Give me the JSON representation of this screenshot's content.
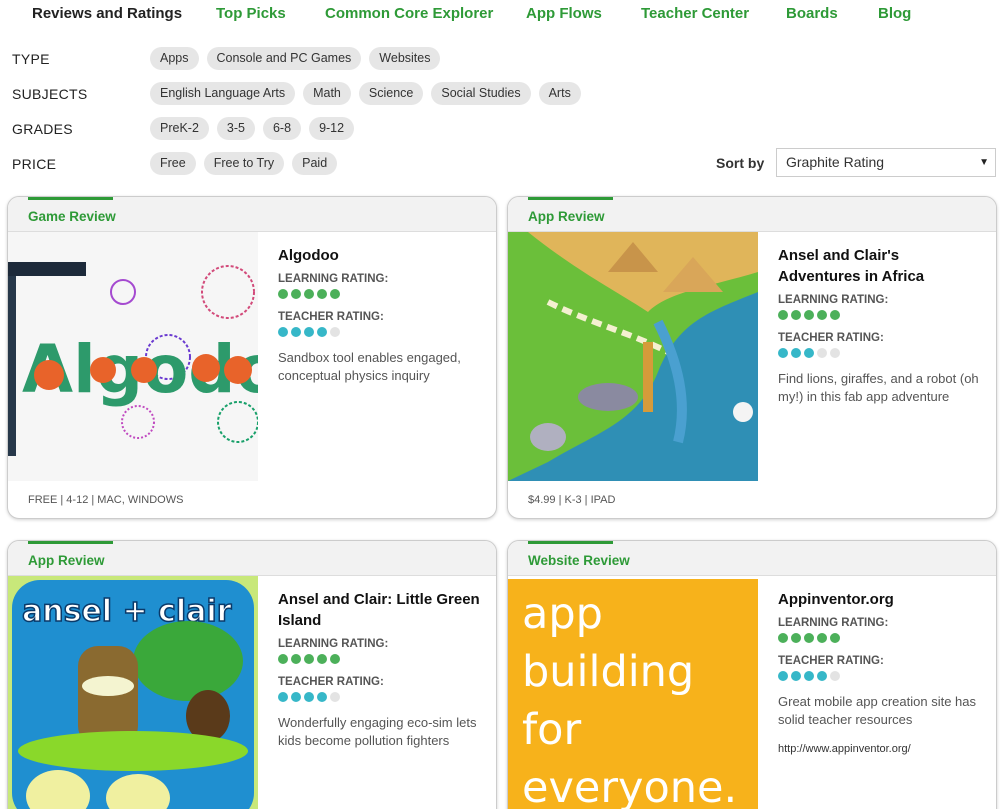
{
  "nav": {
    "items": [
      "Reviews and Ratings",
      "Top Picks",
      "Common Core Explorer",
      "App Flows",
      "Teacher Center",
      "Boards",
      "Blog"
    ]
  },
  "filters": {
    "type": {
      "label": "TYPE",
      "options": [
        "Apps",
        "Console and PC Games",
        "Websites"
      ]
    },
    "subjects": {
      "label": "SUBJECTS",
      "options": [
        "English Language Arts",
        "Math",
        "Science",
        "Social Studies",
        "Arts"
      ]
    },
    "grades": {
      "label": "GRADES",
      "options": [
        "PreK-2",
        "3-5",
        "6-8",
        "9-12"
      ]
    },
    "price": {
      "label": "PRICE",
      "options": [
        "Free",
        "Free to Try",
        "Paid"
      ]
    }
  },
  "sort": {
    "label": "Sort by",
    "value": "Graphite Rating"
  },
  "ratings_labels": {
    "learning": "LEARNING RATING:",
    "teacher": "TEACHER RATING:"
  },
  "cards": [
    {
      "type": "Game Review",
      "title": "Algodoo",
      "learning": 5,
      "teacher": 4,
      "description": "Sandbox tool enables engaged, conceptual physics inquiry",
      "footer": "FREE | 4-12 | MAC, WINDOWS",
      "thumb_text": "Algodoo"
    },
    {
      "type": "App Review",
      "title": "Ansel and Clair's Adventures in Africa",
      "learning": 5,
      "teacher": 3,
      "description": "Find lions, giraffes, and a robot (oh my!) in this fab app adventure",
      "footer": "$4.99 | K-3 | IPAD"
    },
    {
      "type": "App Review",
      "title": "Ansel and Clair: Little Green Island",
      "learning": 5,
      "teacher": 4,
      "description": "Wonderfully engaging eco-sim lets kids become pollution fighters",
      "thumb_text": "ansel + clair"
    },
    {
      "type": "Website Review",
      "title": "Appinventor.org",
      "learning": 5,
      "teacher": 4,
      "description": "Great mobile app creation site has solid teacher resources",
      "url": "http://www.appinventor.org/",
      "thumb_lines": [
        "app",
        "building",
        "for",
        "everyone."
      ]
    }
  ],
  "colors": {
    "accent": "#2e9a37",
    "learning_dot": "#4cb05a",
    "teacher_dot": "#36b7c8",
    "website_thumb": "#f7b21b"
  }
}
